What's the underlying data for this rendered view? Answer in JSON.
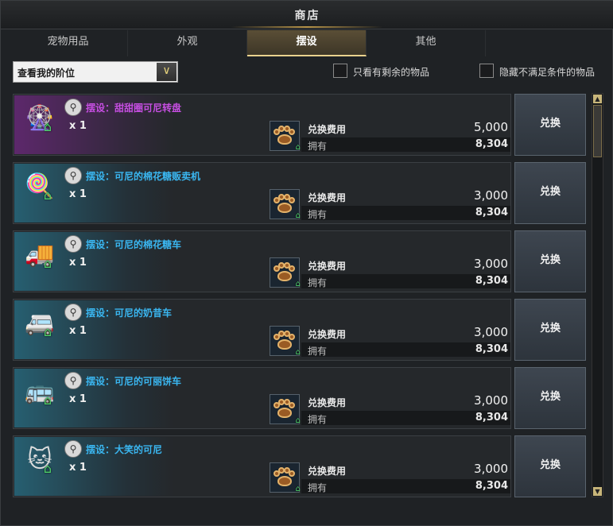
{
  "window": {
    "title": "商店"
  },
  "tabs": [
    {
      "label": "宠物用品"
    },
    {
      "label": "外观"
    },
    {
      "label": "摆设"
    },
    {
      "label": "其他"
    }
  ],
  "active_tab": 2,
  "filter": {
    "dropdown_value": "查看我的阶位",
    "dropdown_arrow": "∨",
    "only_remaining": "只看有剩余的物品",
    "hide_unmet": "隐藏不满足条件的物品"
  },
  "colors": {
    "accent": "#e9d28e",
    "name_blue": "#3ab6f0",
    "name_purple": "#c54ee0",
    "home_green": "#4ed06a"
  },
  "items": [
    {
      "name": "摆设：甜甜圈可尼转盘",
      "qty": "x 1",
      "cost_label": "兑换费用",
      "cost": "5,000",
      "own_label": "拥有",
      "own": "8,304",
      "button": "兑换",
      "icon": "🎡",
      "rarity": "purple"
    },
    {
      "name": "摆设：可尼的棉花糖贩卖机",
      "qty": "x 1",
      "cost_label": "兑换费用",
      "cost": "3,000",
      "own_label": "拥有",
      "own": "8,304",
      "button": "兑换",
      "icon": "🍭",
      "rarity": "blue"
    },
    {
      "name": "摆设：可尼的棉花糖车",
      "qty": "x 1",
      "cost_label": "兑换费用",
      "cost": "3,000",
      "own_label": "拥有",
      "own": "8,304",
      "button": "兑换",
      "icon": "🚚",
      "rarity": "blue"
    },
    {
      "name": "摆设：可尼的奶昔车",
      "qty": "x 1",
      "cost_label": "兑换费用",
      "cost": "3,000",
      "own_label": "拥有",
      "own": "8,304",
      "button": "兑换",
      "icon": "🚐",
      "rarity": "blue"
    },
    {
      "name": "摆设：可尼的可丽饼车",
      "qty": "x 1",
      "cost_label": "兑换费用",
      "cost": "3,000",
      "own_label": "拥有",
      "own": "8,304",
      "button": "兑换",
      "icon": "🚌",
      "rarity": "blue"
    },
    {
      "name": "摆设：大笑的可尼",
      "qty": "x 1",
      "cost_label": "兑换费用",
      "cost": "3,000",
      "own_label": "拥有",
      "own": "8,304",
      "button": "兑换",
      "icon": "🐱",
      "rarity": "blue"
    }
  ],
  "icons": {
    "search": "magnifier-icon",
    "home": "house-icon",
    "currency": "paw-coin-icon"
  }
}
